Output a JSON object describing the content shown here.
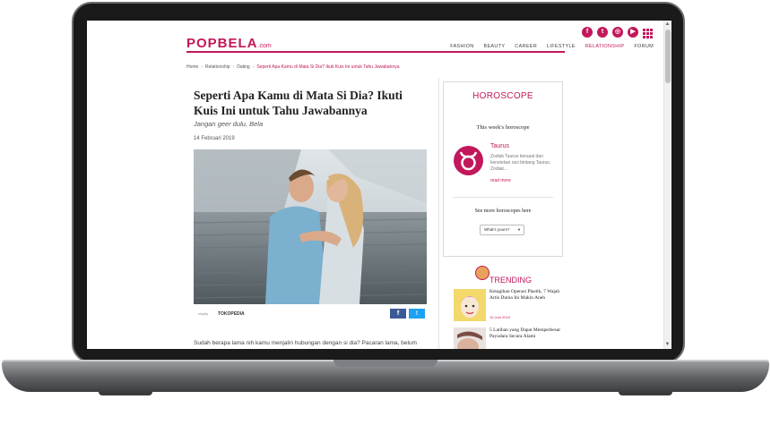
{
  "site": {
    "logo": "POPBELA",
    "logo_suffix": ".com",
    "social": [
      {
        "icon": "facebook-icon",
        "glyph": "f"
      },
      {
        "icon": "twitter-icon",
        "glyph": "t"
      },
      {
        "icon": "instagram-icon",
        "glyph": "◎"
      },
      {
        "icon": "youtube-icon",
        "glyph": "▶"
      }
    ],
    "nav": [
      "FASHION",
      "BEAUTY",
      "CAREER",
      "LIFESTYLE",
      "RELATIONSHIP",
      "FORUM"
    ],
    "active_nav": "RELATIONSHIP",
    "brand_color": "#c2185b"
  },
  "breadcrumb": [
    "Home",
    "Relationship",
    "Dating",
    "Seperti Apa Kamu di Mata Si Dia? Ikuti Kuis Ini untuk Tahu Jawabannya"
  ],
  "article": {
    "title": "Seperti Apa Kamu di Mata Si Dia? Ikuti Kuis Ini untuk Tahu Jawabannya",
    "subtitle": "Jangan geer dulu, Bela",
    "date": "14 Februari 2019",
    "credit_label": "shopify",
    "credit_source": "TOKOPEDIA",
    "share_facebook": "f",
    "share_twitter": "t",
    "body_start": "Sudah berapa lama nih kamu menjalin hubungan dengan si dia? Pacaran lama, belum"
  },
  "horoscope": {
    "title": "HOROSCOPE",
    "week_label": "This week's horoscope",
    "sign": "Taurus",
    "desc": "Zodiak Taurus berasal dari konstelasi rasi bintang Taurus. Zodiak...",
    "read_more": "read more",
    "more_label": "See more horoscopes here",
    "select_value": "What's yours?"
  },
  "trending": {
    "title": "TRENDING",
    "items": [
      {
        "title": "Ketagihan Operasi Plastik, 7 Wajah Artis Dunia Ini Makin Aneh",
        "date": "10 Juni 2019"
      },
      {
        "title": "5 Latihan yang Dapat Memperbesar Payudara Secara Alami",
        "date": ""
      }
    ]
  }
}
